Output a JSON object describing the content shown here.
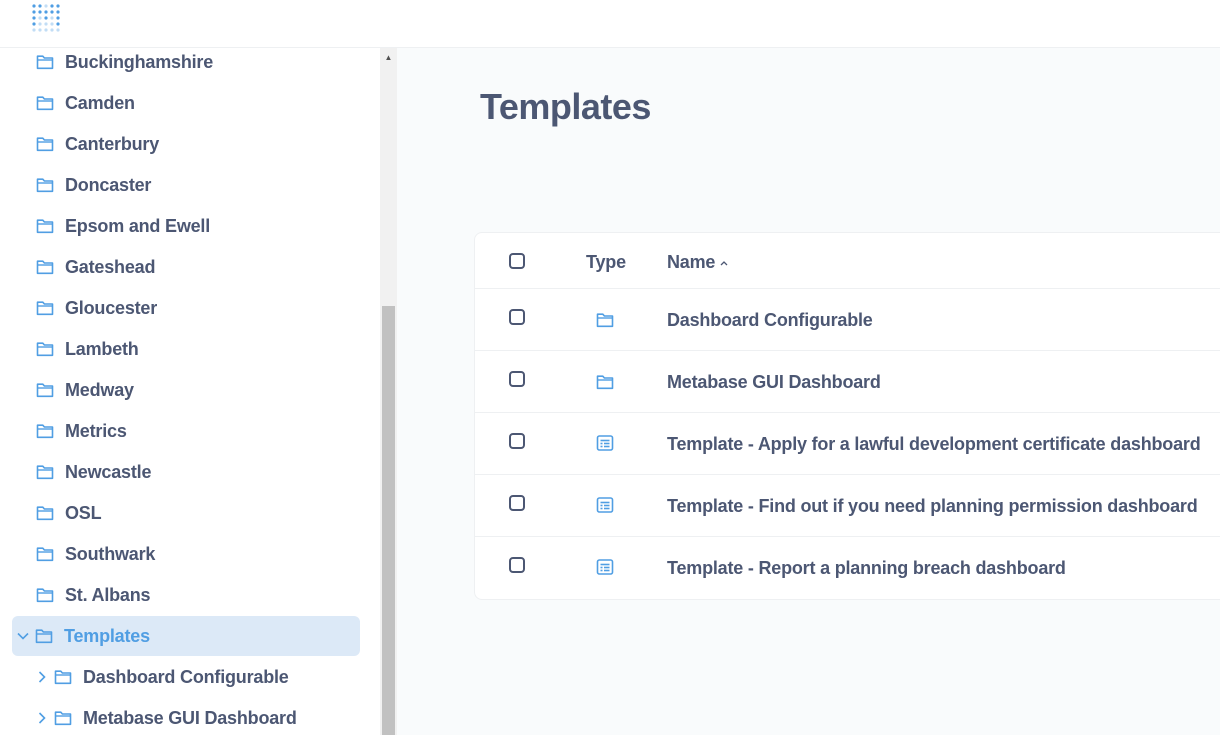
{
  "colors": {
    "accent": "#509ee3",
    "text": "#4c5773",
    "active_bg": "#dce9f7"
  },
  "logo": {
    "icon": "metabase-logo-icon"
  },
  "sidebar": {
    "items": [
      {
        "label": "Buckinghamshire",
        "icon": "folder-icon"
      },
      {
        "label": "Camden",
        "icon": "folder-icon"
      },
      {
        "label": "Canterbury",
        "icon": "folder-icon"
      },
      {
        "label": "Doncaster",
        "icon": "folder-icon"
      },
      {
        "label": "Epsom and Ewell",
        "icon": "folder-icon"
      },
      {
        "label": "Gateshead",
        "icon": "folder-icon"
      },
      {
        "label": "Gloucester",
        "icon": "folder-icon"
      },
      {
        "label": "Lambeth",
        "icon": "folder-icon"
      },
      {
        "label": "Medway",
        "icon": "folder-icon"
      },
      {
        "label": "Metrics",
        "icon": "folder-icon"
      },
      {
        "label": "Newcastle",
        "icon": "folder-icon"
      },
      {
        "label": "OSL",
        "icon": "folder-icon"
      },
      {
        "label": "Southwark",
        "icon": "folder-icon"
      },
      {
        "label": "St. Albans",
        "icon": "folder-icon"
      }
    ],
    "active": {
      "label": "Templates",
      "icon": "folder-icon",
      "expanded": true
    },
    "children": [
      {
        "label": "Dashboard Configurable",
        "icon": "folder-icon"
      },
      {
        "label": "Metabase GUI Dashboard",
        "icon": "folder-icon"
      }
    ]
  },
  "main": {
    "title": "Templates",
    "table": {
      "headers": {
        "type": "Type",
        "name": "Name"
      },
      "sort": "ascending",
      "rows": [
        {
          "type": "collection",
          "name": "Dashboard Configurable"
        },
        {
          "type": "collection",
          "name": "Metabase GUI Dashboard"
        },
        {
          "type": "dashboard",
          "name": "Template - Apply for a lawful development certificate dashboard"
        },
        {
          "type": "dashboard",
          "name": "Template - Find out if you need planning permission dashboard"
        },
        {
          "type": "dashboard",
          "name": "Template - Report a planning breach dashboard"
        }
      ]
    }
  }
}
